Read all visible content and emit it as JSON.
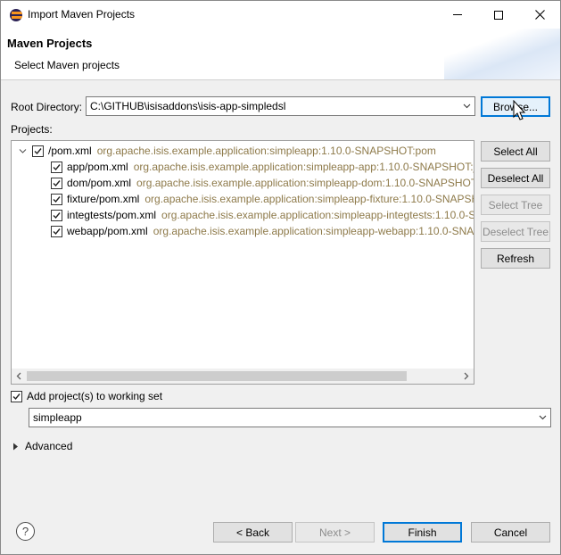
{
  "window": {
    "title": "Import Maven Projects",
    "controls": {
      "minimize": "minimize",
      "maximize": "maximize",
      "close": "close"
    }
  },
  "banner": {
    "title": "Maven Projects",
    "description": "Select Maven projects"
  },
  "root_directory": {
    "label": "Root Directory:",
    "value": "C:\\GITHUB\\isisaddons\\isis-app-simpledsl",
    "browse_label": "Browse..."
  },
  "projects": {
    "label": "Projects:",
    "items": [
      {
        "name": "/pom.xml",
        "artifact": "org.apache.isis.example.application:simpleapp:1.10.0-SNAPSHOT:pom",
        "checked": true,
        "expanded": true
      },
      {
        "name": "app/pom.xml",
        "artifact": "org.apache.isis.example.application:simpleapp-app:1.10.0-SNAPSHOT:ja",
        "checked": true
      },
      {
        "name": "dom/pom.xml",
        "artifact": "org.apache.isis.example.application:simpleapp-dom:1.10.0-SNAPSHOT",
        "checked": true
      },
      {
        "name": "fixture/pom.xml",
        "artifact": "org.apache.isis.example.application:simpleapp-fixture:1.10.0-SNAPSH",
        "checked": true
      },
      {
        "name": "integtests/pom.xml",
        "artifact": "org.apache.isis.example.application:simpleapp-integtests:1.10.0-SI",
        "checked": true
      },
      {
        "name": "webapp/pom.xml",
        "artifact": "org.apache.isis.example.application:simpleapp-webapp:1.10.0-SNAF",
        "checked": true
      }
    ]
  },
  "side_buttons": {
    "select_all": "Select All",
    "deselect_all": "Deselect All",
    "select_tree": "Select Tree",
    "deselect_tree": "Deselect Tree",
    "refresh": "Refresh"
  },
  "working_set": {
    "label": "Add project(s) to working set",
    "checked": true,
    "value": "simpleapp"
  },
  "advanced": {
    "label": "Advanced"
  },
  "footer": {
    "help": "?",
    "back": "< Back",
    "next": "Next >",
    "finish": "Finish",
    "cancel": "Cancel"
  },
  "colors": {
    "artifact_text": "#8e7a4a",
    "focus_border": "#0078d7",
    "disabled_text": "#8c8c8c"
  }
}
